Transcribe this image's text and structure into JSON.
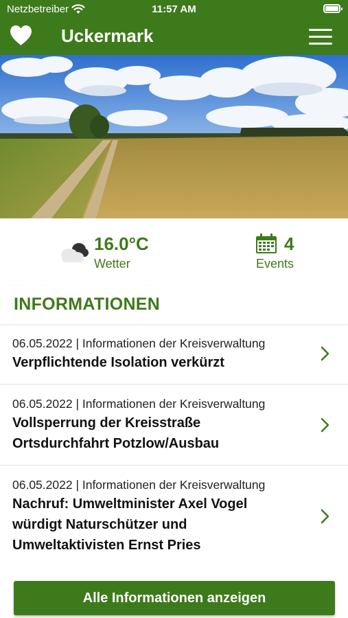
{
  "status_bar": {
    "carrier": "Netzbetreiber",
    "time": "11:57 AM",
    "icons": [
      "wifi-icon",
      "battery-icon"
    ]
  },
  "header": {
    "title": "Uckermark",
    "left_icon": "heart-icon",
    "right_icon": "menu-icon"
  },
  "hero": {
    "image": "landscape-photo-wheat-field-sky"
  },
  "stats": {
    "weather": {
      "icon": "cloud-icon",
      "value": "16.0°C",
      "label": "Wetter"
    },
    "events": {
      "icon": "calendar-icon",
      "value": "4",
      "label": "Events"
    }
  },
  "section": {
    "title": "INFORMATIONEN"
  },
  "news": [
    {
      "meta": "06.05.2022 | Informationen der Kreisverwaltung",
      "title": "Verpflichtende Isolation verkürzt"
    },
    {
      "meta": "06.05.2022 | Informationen der Kreisverwaltung",
      "title": "Vollsperrung der Kreisstraße Ortsdurchfahrt Potzlow/Ausbau"
    },
    {
      "meta": "06.05.2022 | Informationen der Kreisverwaltung",
      "title": "Nachruf: Umweltminister Axel Vogel würdigt Naturschützer und Umweltaktivisten Ernst Pries"
    }
  ],
  "cta": {
    "label": "Alle Informationen anzeigen"
  },
  "colors": {
    "primary": "#3d7a1b",
    "background": "#ffffff",
    "divider": "#e3e3e3"
  }
}
